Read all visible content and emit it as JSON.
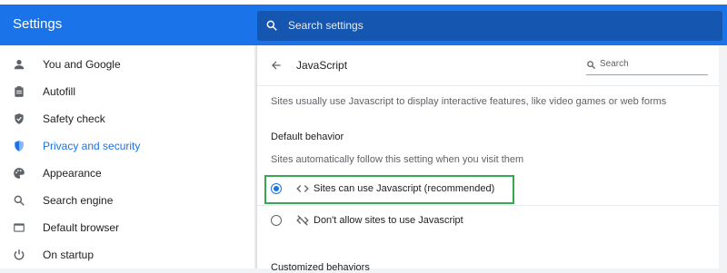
{
  "header": {
    "title": "Settings",
    "search_placeholder": "Search settings"
  },
  "sidebar": {
    "items": [
      {
        "label": "You and Google",
        "icon": "person-icon",
        "active": false
      },
      {
        "label": "Autofill",
        "icon": "clipboard-icon",
        "active": false
      },
      {
        "label": "Safety check",
        "icon": "shield-check-icon",
        "active": false
      },
      {
        "label": "Privacy and security",
        "icon": "shield-icon",
        "active": true
      },
      {
        "label": "Appearance",
        "icon": "palette-icon",
        "active": false
      },
      {
        "label": "Search engine",
        "icon": "search-icon",
        "active": false
      },
      {
        "label": "Default browser",
        "icon": "browser-icon",
        "active": false
      },
      {
        "label": "On startup",
        "icon": "power-icon",
        "active": false
      }
    ]
  },
  "panel": {
    "title": "JavaScript",
    "search_placeholder": "Search",
    "description": "Sites usually use Javascript to display interactive features, like video games or web forms",
    "default_behavior": {
      "title": "Default behavior",
      "subtitle": "Sites automatically follow this setting when you visit them",
      "options": [
        {
          "label": "Sites can use Javascript (recommended)",
          "icon": "code-icon",
          "selected": true
        },
        {
          "label": "Don't allow sites to use Javascript",
          "icon": "code-off-icon",
          "selected": false
        }
      ]
    },
    "customized_title": "Customized behaviors"
  },
  "colors": {
    "accent": "#1a73e8",
    "header_search_bg": "#1557b0",
    "highlight": "#34a853"
  }
}
